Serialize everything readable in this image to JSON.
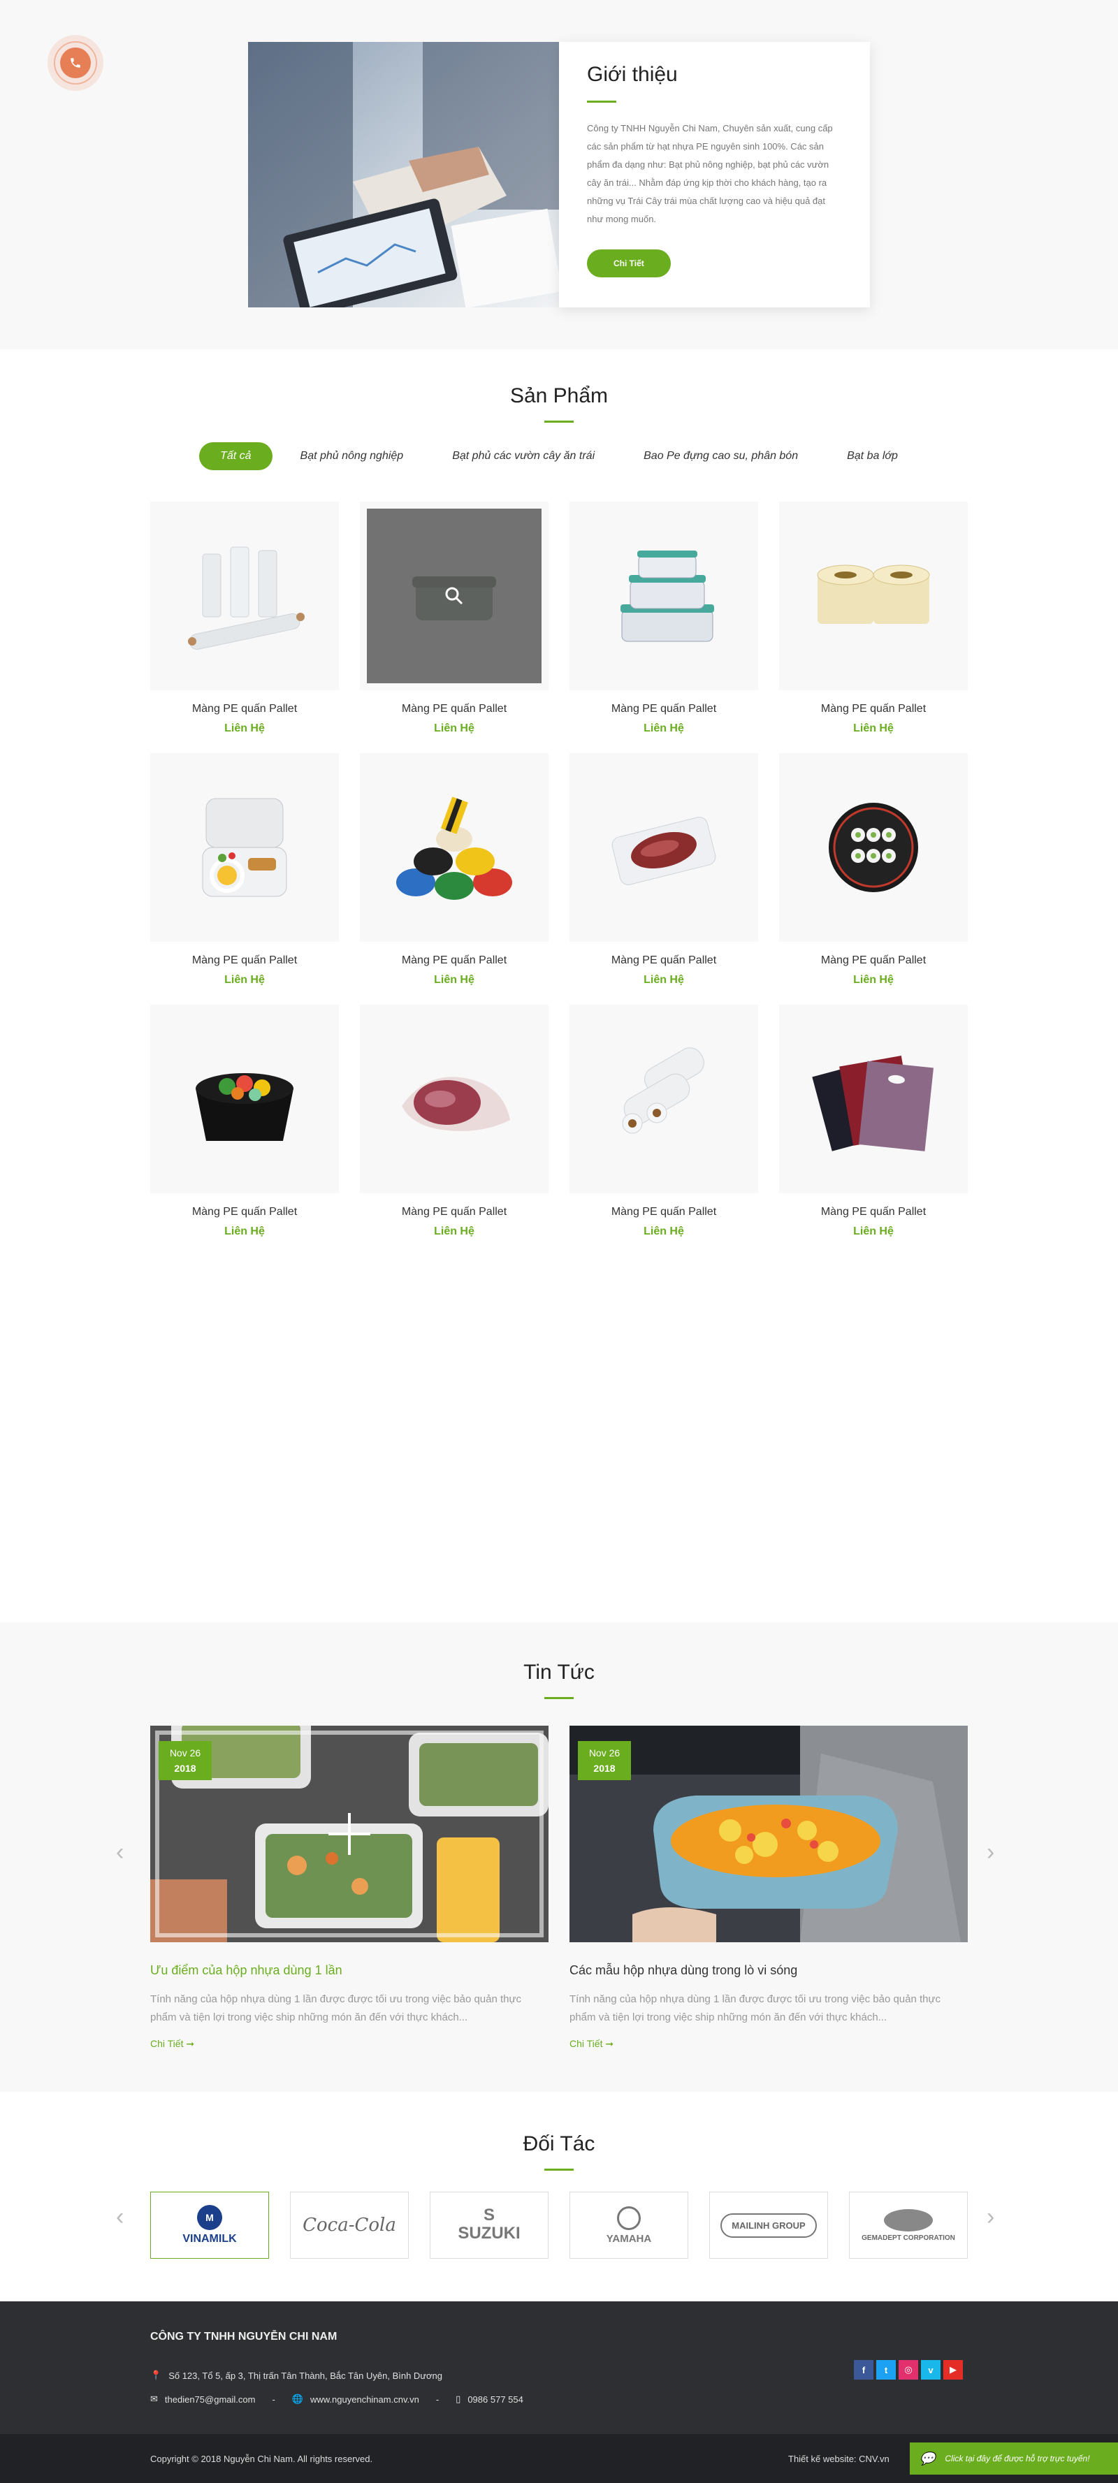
{
  "intro": {
    "title": "Giới thiệu",
    "text": "Công ty TNHH Nguyễn Chi Nam, Chuyên sản xuất, cung cấp các sản phẩm từ hạt nhựa PE nguyên sinh 100%. Các sản phẩm đa dạng như: Bạt phủ nông nghiệp, bạt phủ các vườn cây ăn trái... Nhằm đáp ứng kịp thời cho khách hàng, tạo ra những vụ Trái Cây trái mùa chất lượng cao và hiệu quả đạt như mong muốn.",
    "button": "Chi Tiết"
  },
  "products": {
    "title": "Sản Phẩm",
    "tabs": [
      "Tất cả",
      "Bạt phủ nông nghiệp",
      "Bạt phủ các vườn cây ăn trái",
      "Bao Pe đựng cao su, phân bón",
      "Bạt ba lớp"
    ],
    "items": [
      {
        "name": "Màng PE quấn Pallet",
        "link": "Liên Hệ",
        "icon": "stretch-film-rolls"
      },
      {
        "name": "Màng PE quấn Pallet",
        "link": "Liên Hệ",
        "icon": "food-container"
      },
      {
        "name": "Màng PE quấn Pallet",
        "link": "Liên Hệ",
        "icon": "stacked-containers"
      },
      {
        "name": "Màng PE quấn Pallet",
        "link": "Liên Hệ",
        "icon": "tape-rolls"
      },
      {
        "name": "Màng PE quấn Pallet",
        "link": "Liên Hệ",
        "icon": "lunch-box"
      },
      {
        "name": "Màng PE quấn Pallet",
        "link": "Liên Hệ",
        "icon": "colored-tapes"
      },
      {
        "name": "Màng PE quấn Pallet",
        "link": "Liên Hệ",
        "icon": "vacuum-meat"
      },
      {
        "name": "Màng PE quấn Pallet",
        "link": "Liên Hệ",
        "icon": "sushi-tray"
      },
      {
        "name": "Màng PE quấn Pallet",
        "link": "Liên Hệ",
        "icon": "salad-box"
      },
      {
        "name": "Màng PE quấn Pallet",
        "link": "Liên Hệ",
        "icon": "wrapped-meat"
      },
      {
        "name": "Màng PE quấn Pallet",
        "link": "Liên Hệ",
        "icon": "film-rolls"
      },
      {
        "name": "Màng PE quấn Pallet",
        "link": "Liên Hệ",
        "icon": "bags"
      }
    ]
  },
  "news": {
    "title": "Tin Tức",
    "posts": [
      {
        "date_day": "Nov 26",
        "date_year": "2018",
        "title": "Ưu điểm của hộp nhựa dùng 1 lần",
        "excerpt": "Tính năng của hộp nhựa dùng 1 lần được được tối ưu trong việc bảo quản thực phẩm và tiện lợi trong việc ship những món ăn đến với thực khách...",
        "more": "Chi Tiết"
      },
      {
        "date_day": "Nov 26",
        "date_year": "2018",
        "title": "Các mẫu hộp nhựa dùng trong lò vi sóng",
        "excerpt": "Tính năng của hộp nhựa dùng 1 lần được được tối ưu trong việc bảo quản thực phẩm và tiện lợi trong việc ship những món ăn đến với thực khách...",
        "more": "Chi Tiết"
      }
    ]
  },
  "partners": {
    "title": "Đối Tác",
    "logos": [
      "VINAMILK",
      "Coca-Cola",
      "SUZUKI",
      "YAMAHA",
      "MAILINH GROUP",
      "GEMADEPT CORPORATION"
    ]
  },
  "footer": {
    "company": "CÔNG TY TNHH NGUYỄN CHI NAM",
    "address": "Số 123, Tổ 5, ấp 3, Thị trấn Tân Thành, Bắc Tân Uyên, Bình Dương",
    "email": "thedien75@gmail.com",
    "website": "www.nguyenchinam.cnv.vn",
    "phone": "0986 577 554",
    "separator": "-",
    "copyright": "Copyright © 2018 Nguyễn Chi Nam. All rights reserved.",
    "designer": "Thiết kế website: CNV.vn",
    "chat": "Click tại đây để được hỗ trợ trực tuyến!",
    "socials": [
      {
        "name": "facebook",
        "glyph": "f",
        "color": "#3b5998"
      },
      {
        "name": "twitter",
        "glyph": "t",
        "color": "#1da1f2"
      },
      {
        "name": "instagram",
        "glyph": "◎",
        "color": "#e1306c"
      },
      {
        "name": "vimeo",
        "glyph": "v",
        "color": "#1ab7ea"
      },
      {
        "name": "youtube",
        "glyph": "▶",
        "color": "#e52d27"
      }
    ]
  }
}
